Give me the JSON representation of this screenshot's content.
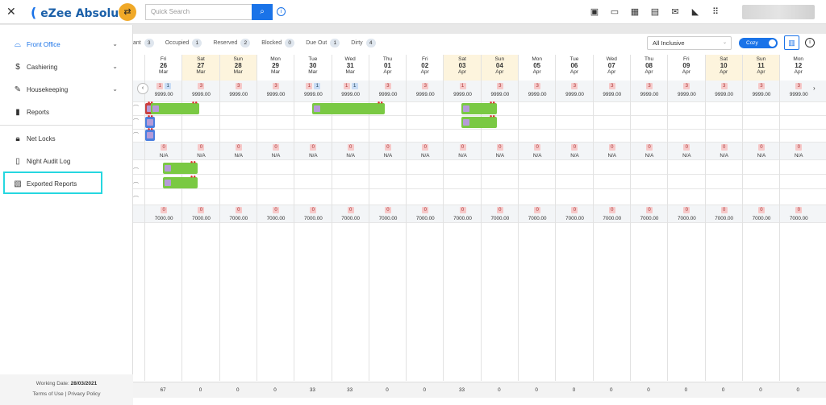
{
  "app": {
    "brand": "eZee Absolute",
    "close_glyph": "✕"
  },
  "search": {
    "placeholder": "Quick Search"
  },
  "sidebar": {
    "items": [
      {
        "label": "Front Office",
        "icon": "front-desk-icon",
        "chevron": true,
        "active": true
      },
      {
        "label": "Cashiering",
        "icon": "dollar-icon",
        "chevron": true
      },
      {
        "label": "Housekeeping",
        "icon": "broom-icon",
        "chevron": true
      },
      {
        "label": "Reports",
        "icon": "bar-chart-icon",
        "chevron": false
      },
      {
        "label": "Net Locks",
        "icon": "lock-icon",
        "chevron": false
      },
      {
        "label": "Night Audit Log",
        "icon": "audit-log-icon",
        "chevron": false
      },
      {
        "label": "Exported Reports",
        "icon": "export-report-icon",
        "chevron": false
      }
    ],
    "working_date_label": "Working Date:",
    "working_date": "28/03/2021",
    "terms": "Terms of Use",
    "separator": "|",
    "privacy": "Privacy Policy"
  },
  "status": [
    {
      "label": "ant",
      "count": "3"
    },
    {
      "label": "Occupied",
      "count": "1"
    },
    {
      "label": "Reserved",
      "count": "2"
    },
    {
      "label": "Blocked",
      "count": "0"
    },
    {
      "label": "Due Out",
      "count": "1"
    },
    {
      "label": "Dirty",
      "count": "4"
    }
  ],
  "rate_select": {
    "value": "All Inclusive"
  },
  "view_toggle": {
    "label": "Cozy"
  },
  "days": [
    {
      "dow": "Fri",
      "d": "26",
      "m": "Mar",
      "we": false
    },
    {
      "dow": "Sat",
      "d": "27",
      "m": "Mar",
      "we": true
    },
    {
      "dow": "Sun",
      "d": "28",
      "m": "Mar",
      "we": true
    },
    {
      "dow": "Mon",
      "d": "29",
      "m": "Mar",
      "we": false
    },
    {
      "dow": "Tue",
      "d": "30",
      "m": "Mar",
      "we": false
    },
    {
      "dow": "Wed",
      "d": "31",
      "m": "Mar",
      "we": false
    },
    {
      "dow": "Thu",
      "d": "01",
      "m": "Apr",
      "we": false
    },
    {
      "dow": "Fri",
      "d": "02",
      "m": "Apr",
      "we": false
    },
    {
      "dow": "Sat",
      "d": "03",
      "m": "Apr",
      "we": true
    },
    {
      "dow": "Sun",
      "d": "04",
      "m": "Apr",
      "we": true
    },
    {
      "dow": "Mon",
      "d": "05",
      "m": "Apr",
      "we": false
    },
    {
      "dow": "Tue",
      "d": "06",
      "m": "Apr",
      "we": false
    },
    {
      "dow": "Wed",
      "d": "07",
      "m": "Apr",
      "we": false
    },
    {
      "dow": "Thu",
      "d": "08",
      "m": "Apr",
      "we": false
    },
    {
      "dow": "Fri",
      "d": "09",
      "m": "Apr",
      "we": false
    },
    {
      "dow": "Sat",
      "d": "10",
      "m": "Apr",
      "we": true
    },
    {
      "dow": "Sun",
      "d": "11",
      "m": "Apr",
      "we": true
    },
    {
      "dow": "Mon",
      "d": "12",
      "m": "Apr",
      "we": false
    }
  ],
  "room_type_1": {
    "avail": [
      "1",
      "3",
      "3",
      "3",
      "1",
      "1",
      "3",
      "3",
      "1",
      "3",
      "3",
      "3",
      "3",
      "3",
      "3",
      "3",
      "3",
      "3"
    ],
    "avail2": [
      "1",
      "",
      "",
      "",
      "1",
      "1",
      "",
      "",
      "",
      "",
      "",
      "",
      "",
      "",
      "",
      "",
      "",
      ""
    ],
    "rate": [
      "9999.00",
      "9999.00",
      "9999.00",
      "9999.00",
      "9999.00",
      "9999.00",
      "9999.00",
      "9999.00",
      "9999.00",
      "9999.00",
      "9999.00",
      "9999.00",
      "9999.00",
      "9999.00",
      "9999.00",
      "9999.00",
      "9999.00",
      "9999.00"
    ]
  },
  "room_type_2": {
    "avail": [
      "0",
      "0",
      "0",
      "0",
      "0",
      "0",
      "0",
      "0",
      "0",
      "0",
      "0",
      "0",
      "0",
      "0",
      "0",
      "0",
      "0",
      "0"
    ],
    "rate": [
      "N/A",
      "N/A",
      "N/A",
      "N/A",
      "N/A",
      "N/A",
      "N/A",
      "N/A",
      "N/A",
      "N/A",
      "N/A",
      "N/A",
      "N/A",
      "N/A",
      "N/A",
      "N/A",
      "N/A",
      "N/A"
    ]
  },
  "room_type_3": {
    "avail": [
      "0",
      "0",
      "0",
      "0",
      "0",
      "0",
      "0",
      "0",
      "0",
      "0",
      "0",
      "0",
      "0",
      "0",
      "0",
      "0",
      "0",
      "0"
    ],
    "rate": [
      "7000.00",
      "7000.00",
      "7000.00",
      "7000.00",
      "7000.00",
      "7000.00",
      "7000.00",
      "7000.00",
      "7000.00",
      "7000.00",
      "7000.00",
      "7000.00",
      "7000.00",
      "7000.00",
      "7000.00",
      "7000.00",
      "7000.00",
      "7000.00"
    ]
  },
  "totals": [
    "67",
    "0",
    "0",
    "0",
    "33",
    "33",
    "0",
    "0",
    "33",
    "0",
    "0",
    "0",
    "0",
    "0",
    "0",
    "0",
    "0",
    "0"
  ],
  "colors": {
    "accent": "#1a73e8",
    "highlight": "#26d7e0",
    "booking": "#7ac943",
    "weekend": "#fdf4dd"
  }
}
